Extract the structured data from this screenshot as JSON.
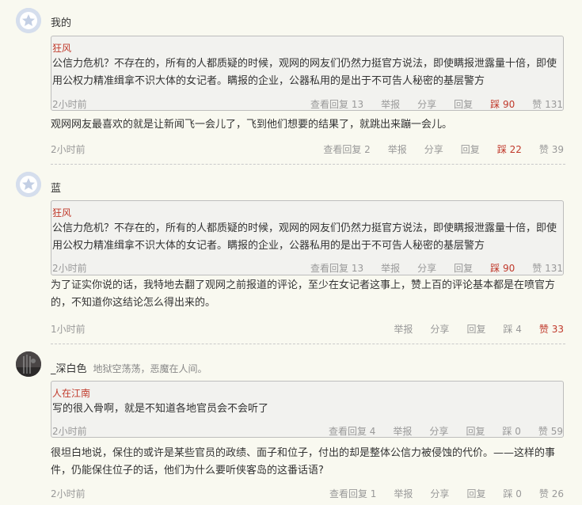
{
  "quote_common": {
    "author": "狂风",
    "text": "公信力危机？不存在的，所有的人都质疑的时候，观网的网友们仍然力挺官方说法，即使瞒报泄露量十倍，即使用公权力精准缉拿不识大体的女记者。瞒报的企业，公器私用的是出于不可告人秘密的基层警方",
    "time": "2小时前",
    "replies": "查看回复 13",
    "report": "举报",
    "share": "分享",
    "reply": "回复",
    "down": "踩 90",
    "up": "赞 131"
  },
  "comments": [
    {
      "user": "我的",
      "body": "观网网友最喜欢的就是让新闻飞一会儿了，飞到他们想要的结果了，就跳出来蹦一会儿。",
      "time": "2小时前",
      "replies": "查看回复 2",
      "report": "举报",
      "share": "分享",
      "reply": "回复",
      "down": "踩 22",
      "up": "赞 39"
    },
    {
      "user": "蓝",
      "body": "为了证实你说的话，我特地去翻了观网之前报道的评论，至少在女记者这事上，赞上百的评论基本都是在喷官方的，不知道你这结论怎么得出来的。",
      "time": "1小时前",
      "report": "举报",
      "share": "分享",
      "reply": "回复",
      "down": "踩 4",
      "up": "赞 33"
    },
    {
      "user": "_深白色",
      "motto": "地狱空荡荡，恶魔在人间。",
      "quote_author": "人在江南",
      "quote_text": "写的很入骨啊，就是不知道各地官员会不会听了",
      "quote_time": "2小时前",
      "quote_replies": "查看回复 4",
      "quote_report": "举报",
      "quote_share": "分享",
      "quote_reply": "回复",
      "quote_down": "踩 0",
      "quote_up": "赞 59",
      "body": "很坦白地说，保住的或许是某些官员的政绩、面子和位子，付出的却是整体公信力被侵蚀的代价。——这样的事件，仍能保住位子的话，他们为什么要听侠客岛的这番话语?",
      "time": "2小时前",
      "replies": "查看回复 1",
      "report": "举报",
      "share": "分享",
      "reply": "回复",
      "down": "踩 0",
      "up": "赞 26"
    }
  ]
}
